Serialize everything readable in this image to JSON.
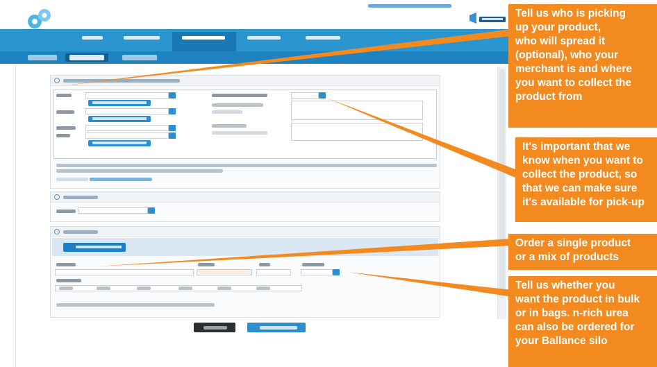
{
  "annotations": [
    {
      "text": "Tell us who is picking\nup your product,\nwho will spread it\n(optional), who your\nmerchant is and where\nyou want to collect the\nproduct from"
    },
    {
      "text": "It's important that we\nknow when you want to\ncollect the product, so\nthat we can make sure\nit's available for pick-up"
    },
    {
      "text": "Order a single product\nor a mix of products"
    },
    {
      "text": "Tell us whether you\nwant the product in bulk\nor in bags. n-rich urea\ncan also be ordered for\nyour Ballance silo"
    }
  ],
  "colors": {
    "annotation_orange": "#f38a1f",
    "nav_blue": "#2b95cf",
    "nav_active": "#1a78b3",
    "button_blue": "#2b8ed0"
  },
  "icons": [
    "logo-mark-icon",
    "ballance-brand-logo",
    "panel-bullet-icon",
    "dropdown-arrow-icon"
  ]
}
